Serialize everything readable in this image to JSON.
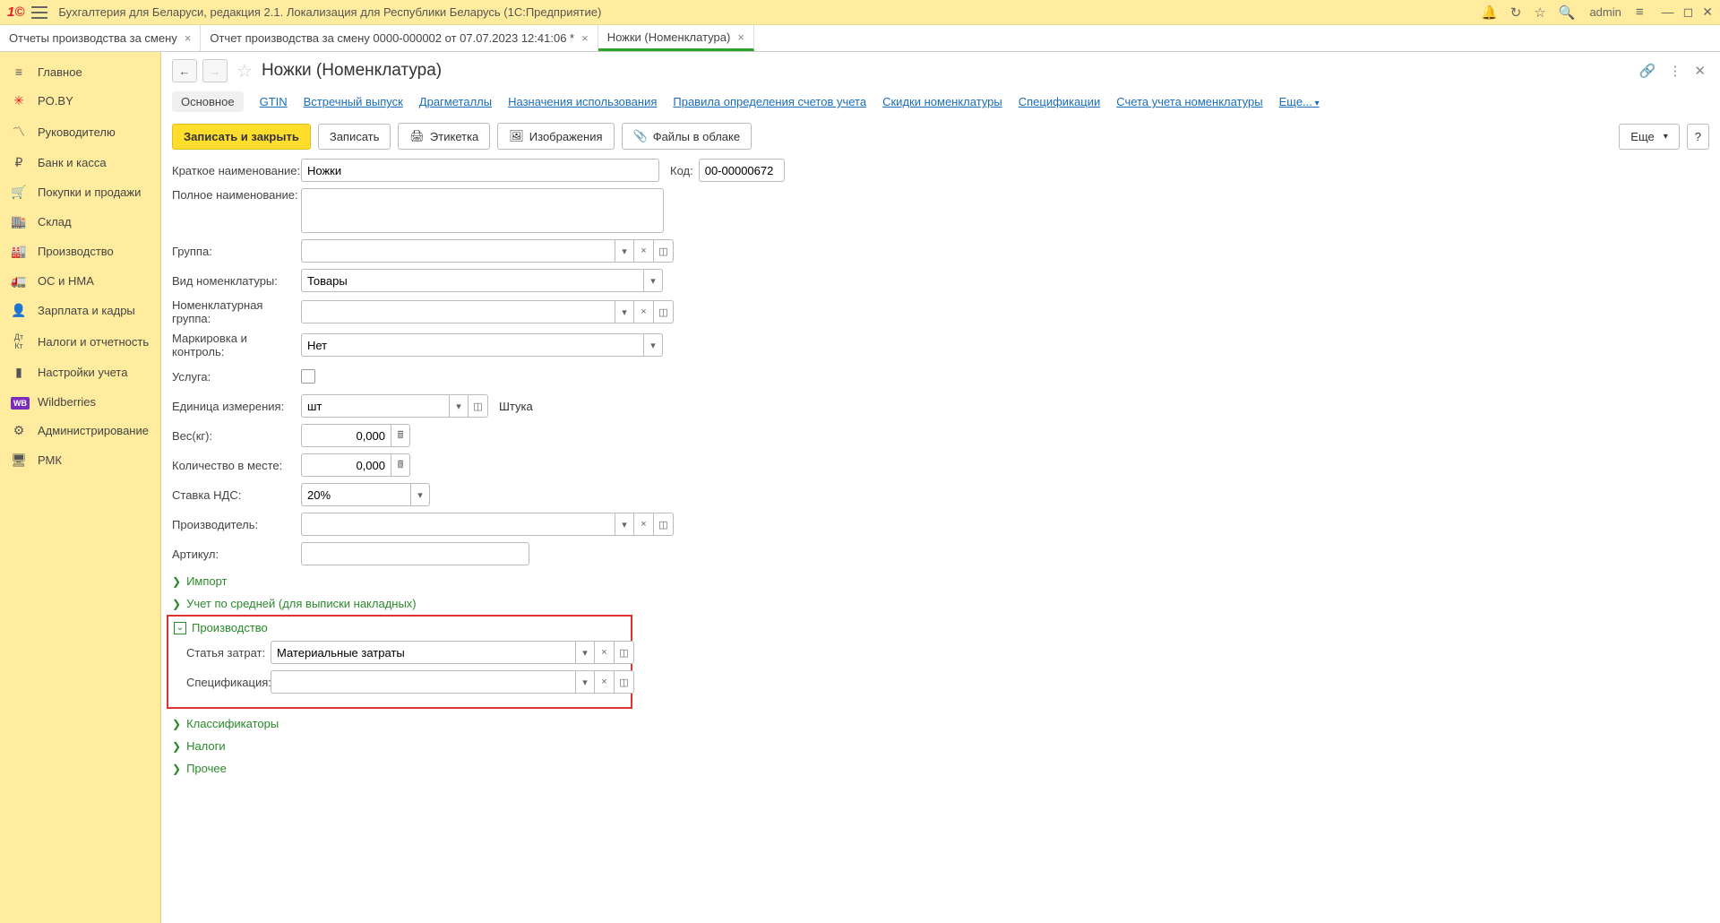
{
  "titlebar": {
    "app_title": "Бухгалтерия для Беларуси, редакция 2.1. Локализация для Республики Беларусь   (1С:Предприятие)",
    "user": "admin"
  },
  "tabs": [
    {
      "label": "Отчеты производства за смену",
      "active": false
    },
    {
      "label": "Отчет производства за смену 0000-000002 от 07.07.2023 12:41:06 *",
      "active": false
    },
    {
      "label": "Ножки (Номенклатура)",
      "active": true
    }
  ],
  "sidebar": {
    "items": [
      {
        "label": "Главное",
        "icon": "≡"
      },
      {
        "label": "PO.BY",
        "icon": "✳"
      },
      {
        "label": "Руководителю",
        "icon": "📈"
      },
      {
        "label": "Банк и касса",
        "icon": "₽"
      },
      {
        "label": "Покупки и продажи",
        "icon": "🛒"
      },
      {
        "label": "Склад",
        "icon": "📦"
      },
      {
        "label": "Производство",
        "icon": "🏭"
      },
      {
        "label": "ОС и НМА",
        "icon": "🚚"
      },
      {
        "label": "Зарплата и кадры",
        "icon": "👤"
      },
      {
        "label": "Налоги и отчетность",
        "icon": "Дт"
      },
      {
        "label": "Настройки учета",
        "icon": "📋"
      },
      {
        "label": "Wildberries",
        "icon": "WB"
      },
      {
        "label": "Администрирование",
        "icon": "⚙"
      },
      {
        "label": "РМК",
        "icon": "🖥"
      }
    ]
  },
  "page": {
    "title": "Ножки (Номенклатура)"
  },
  "subtabs": [
    {
      "label": "Основное",
      "active": true
    },
    {
      "label": "GTIN"
    },
    {
      "label": "Встречный выпуск"
    },
    {
      "label": "Драгметаллы"
    },
    {
      "label": "Назначения использования"
    },
    {
      "label": "Правила определения счетов учета"
    },
    {
      "label": "Скидки номенклатуры"
    },
    {
      "label": "Спецификации"
    },
    {
      "label": "Счета учета номенклатуры"
    },
    {
      "label": "Еще...",
      "more": true
    }
  ],
  "toolbar": {
    "save_close": "Записать и закрыть",
    "save": "Записать",
    "label": "Этикетка",
    "images": "Изображения",
    "files": "Файлы в облаке",
    "more": "Еще",
    "help": "?"
  },
  "form": {
    "short_name_label": "Краткое наименование:",
    "short_name_value": "Ножки",
    "code_label": "Код:",
    "code_value": "00-00000672",
    "full_name_label": "Полное наименование:",
    "full_name_value": "",
    "group_label": "Группа:",
    "group_value": "",
    "type_label": "Вид номенклатуры:",
    "type_value": "Товары",
    "nom_group_label": "Номенклатурная группа:",
    "nom_group_value": "",
    "marking_label": "Маркировка и контроль:",
    "marking_value": "Нет",
    "service_label": "Услуга:",
    "unit_label": "Единица измерения:",
    "unit_value": "шт",
    "unit_text": "Штука",
    "weight_label": "Вес(кг):",
    "weight_value": "0,000",
    "qty_label": "Количество в месте:",
    "qty_value": "0,000",
    "vat_label": "Ставка НДС:",
    "vat_value": "20%",
    "manufacturer_label": "Производитель:",
    "manufacturer_value": "",
    "article_label": "Артикул:",
    "article_value": ""
  },
  "sections": {
    "import": "Импорт",
    "avg": "Учет по средней (для выписки накладных)",
    "production": "Производство",
    "prod_cost_label": "Статья затрат:",
    "prod_cost_value": "Материальные затраты",
    "spec_label": "Спецификация:",
    "spec_value": "",
    "classifiers": "Классификаторы",
    "taxes": "Налоги",
    "other": "Прочее"
  }
}
